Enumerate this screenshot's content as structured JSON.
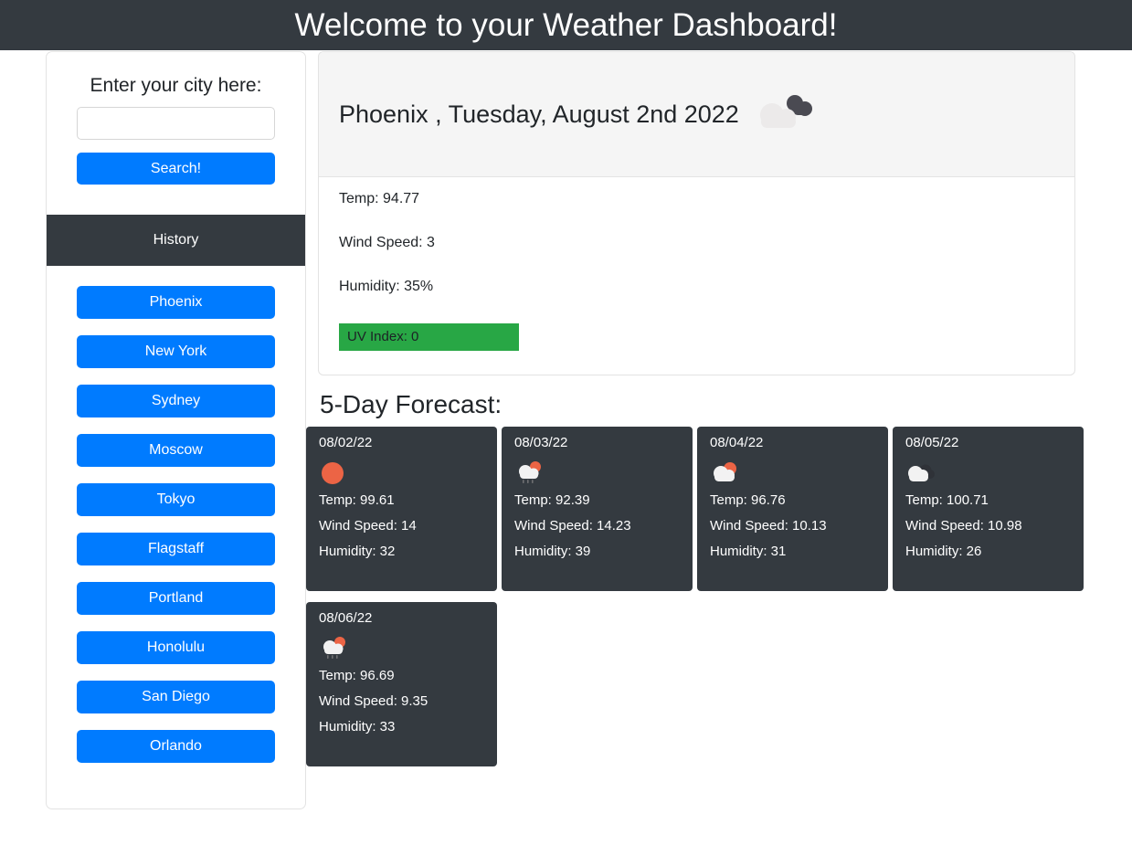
{
  "header": {
    "title": "Welcome to your Weather Dashboard!"
  },
  "sidebar": {
    "search_label": "Enter your city here:",
    "search_value": "",
    "search_placeholder": "",
    "search_button": "Search!",
    "history_header": "History",
    "cities": [
      "Phoenix",
      "New York",
      "Sydney",
      "Moscow",
      "Tokyo",
      "Flagstaff",
      "Portland",
      "Honolulu",
      "San Diego",
      "Orlando"
    ]
  },
  "today": {
    "title": "Phoenix , Tuesday, August 2nd 2022",
    "icon": "broken-clouds-icon",
    "temp": "Temp: 94.77",
    "wind": "Wind Speed: 3",
    "humidity": "Humidity: 35%",
    "uv_index": "UV Index: 0",
    "uv_color": "#28a745"
  },
  "forecast": {
    "title": "5-Day Forecast:",
    "cards": [
      {
        "date": "08/02/22",
        "icon": "clear-sun-icon",
        "temp": "Temp: 99.61",
        "wind": "Wind Speed: 14",
        "humidity": "Humidity: 32"
      },
      {
        "date": "08/03/22",
        "icon": "sun-cloud-rain-icon",
        "temp": "Temp: 92.39",
        "wind": "Wind Speed: 14.23",
        "humidity": "Humidity: 39"
      },
      {
        "date": "08/04/22",
        "icon": "sun-behind-cloud-icon",
        "temp": "Temp: 96.76",
        "wind": "Wind Speed: 10.13",
        "humidity": "Humidity: 31"
      },
      {
        "date": "08/05/22",
        "icon": "broken-clouds-icon",
        "temp": "Temp: 100.71",
        "wind": "Wind Speed: 10.98",
        "humidity": "Humidity: 26"
      },
      {
        "date": "08/06/22",
        "icon": "sun-cloud-rain-icon",
        "temp": "Temp: 96.69",
        "wind": "Wind Speed: 9.35",
        "humidity": "Humidity: 33"
      }
    ]
  },
  "colors": {
    "brand_dark": "#343a40",
    "accent_blue": "#007bff",
    "uv_green": "#28a745",
    "sun_orange": "#ec6445"
  }
}
